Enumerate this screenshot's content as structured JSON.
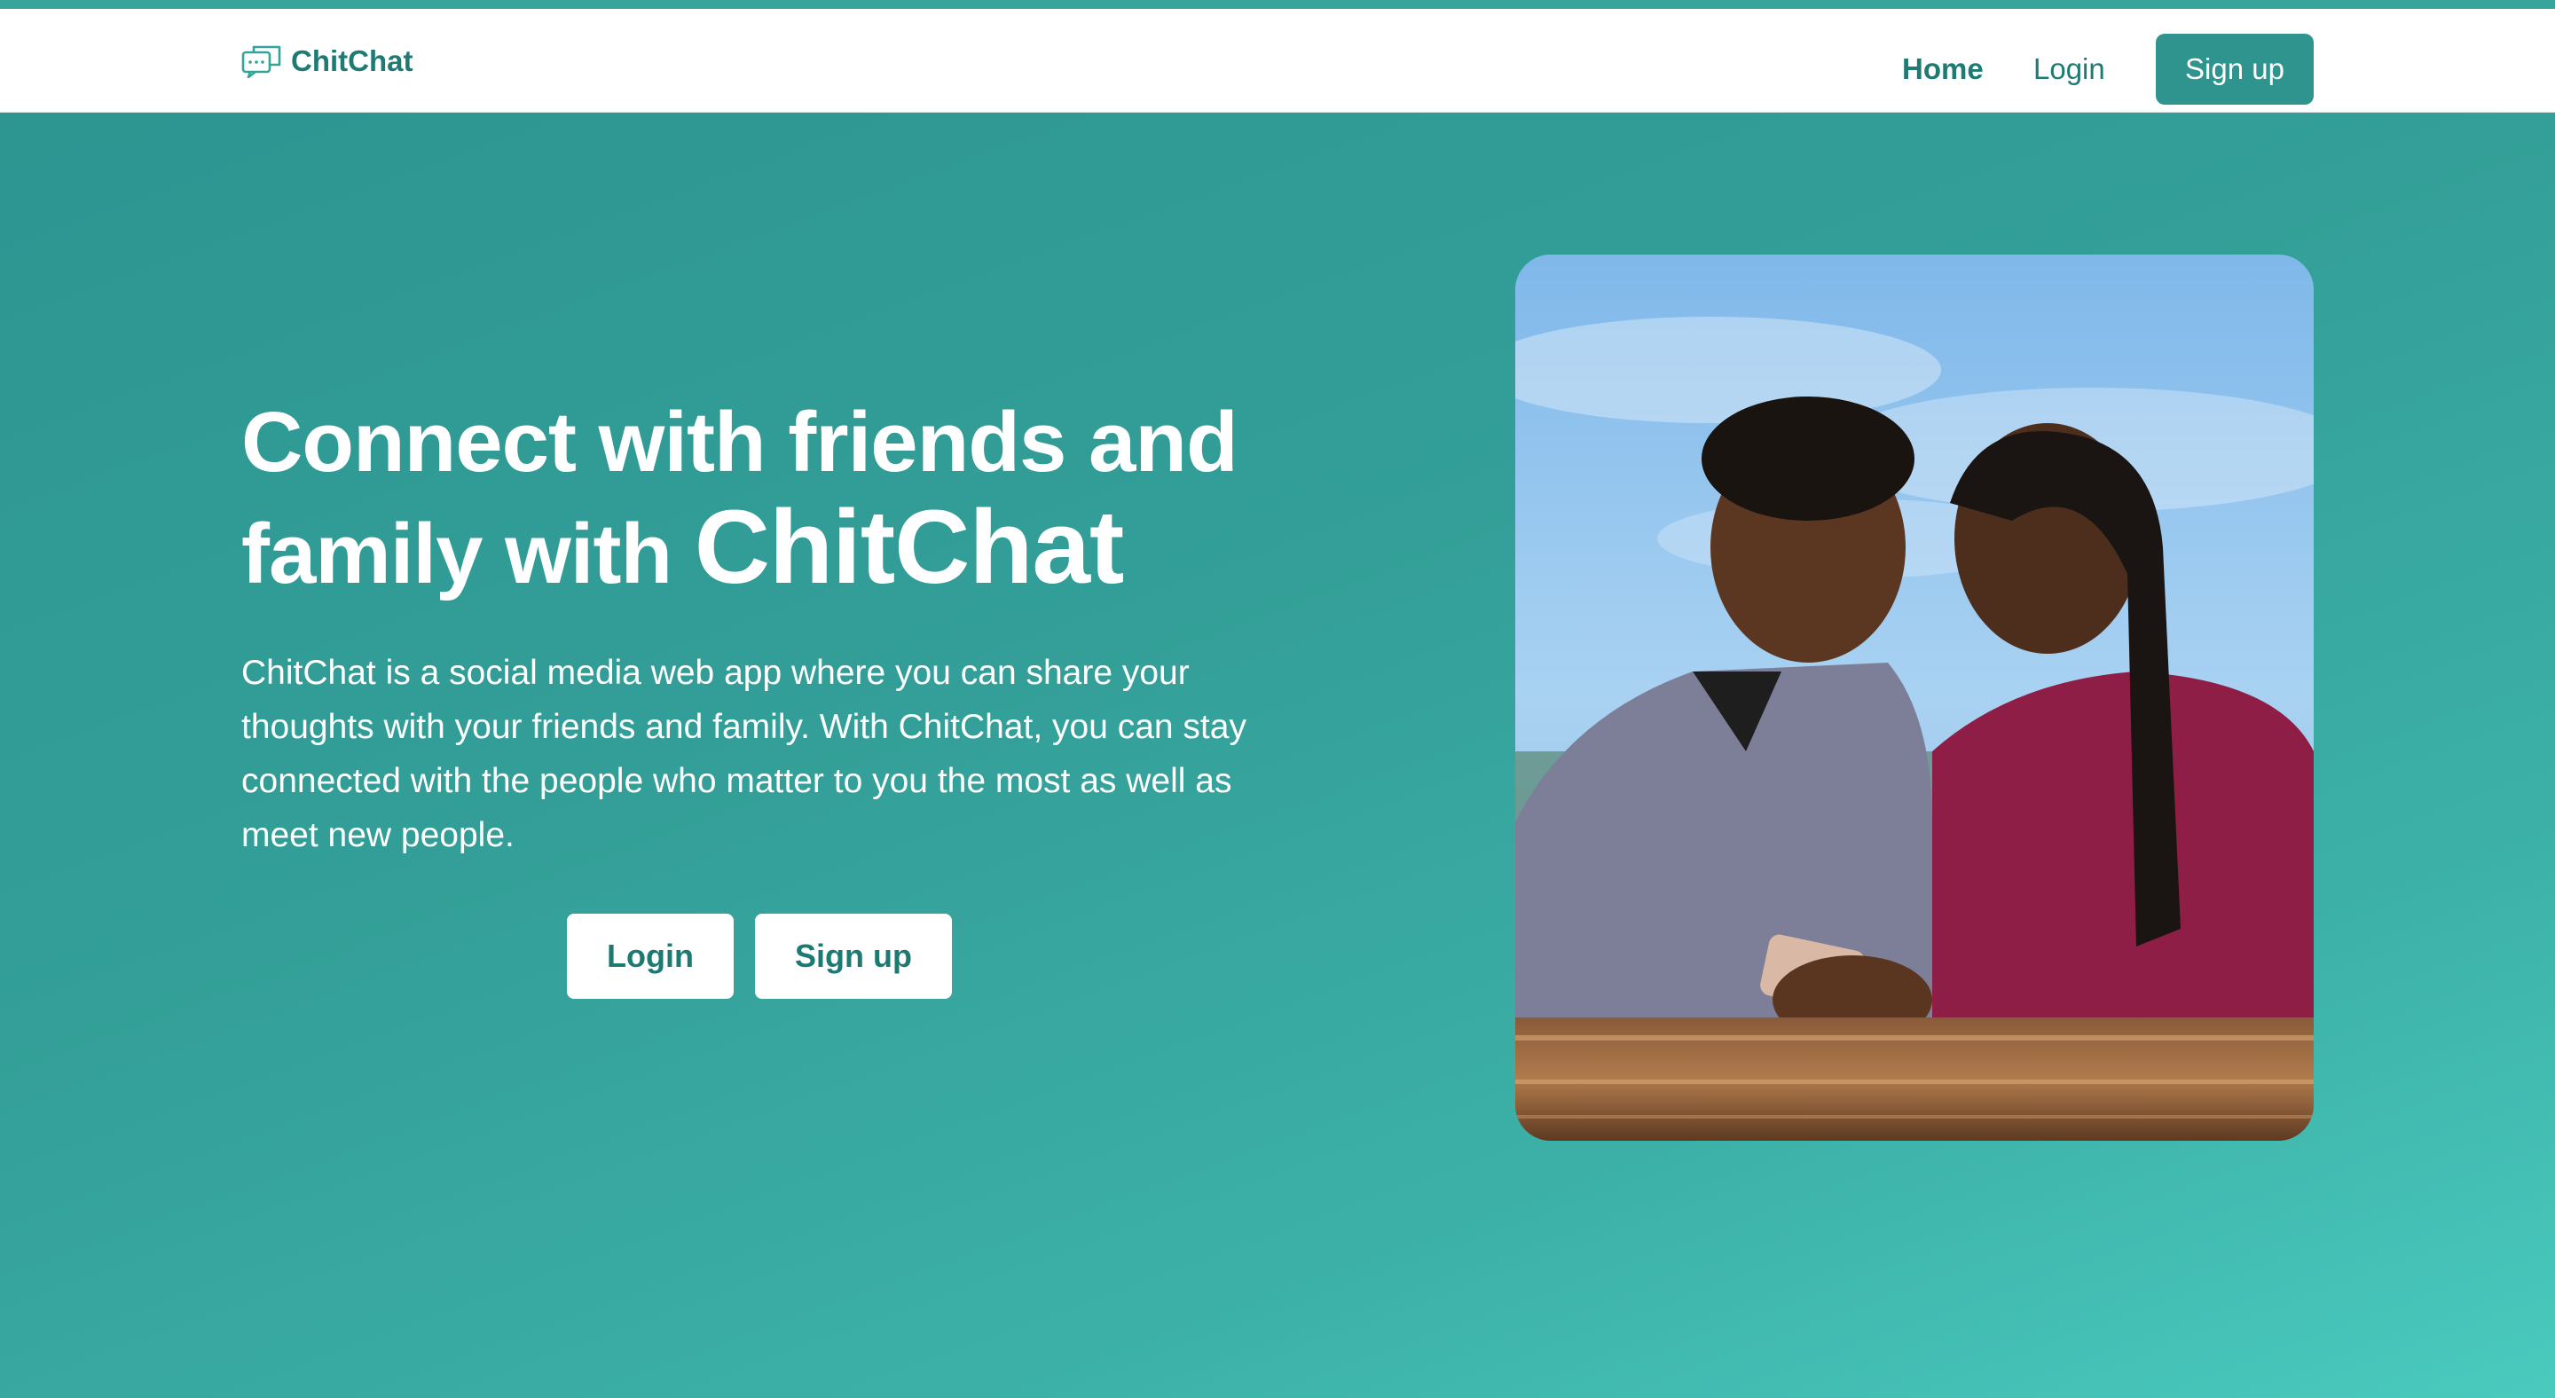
{
  "navbar": {
    "brand": {
      "name": "ChitChat",
      "icon": "chat-bubbles-icon"
    },
    "links": {
      "home": "Home",
      "login": "Login"
    },
    "signup_label": "Sign up"
  },
  "hero": {
    "title_line1": "Connect with friends and",
    "title_line2_prefix": "family with",
    "title_brand": "ChitChat",
    "description": "ChitChat is a social media web app where you can share your thoughts with your friends and family. With ChitChat, you can stay connected with the people who matter to you the most as well as meet new people.",
    "login_label": "Login",
    "signup_label": "Sign up"
  },
  "colors": {
    "primary": "#2f938e",
    "brand_text": "#1f7a74",
    "background_gradient_start": "#2d9490",
    "background_gradient_end": "#4acabe",
    "white": "#ffffff"
  }
}
